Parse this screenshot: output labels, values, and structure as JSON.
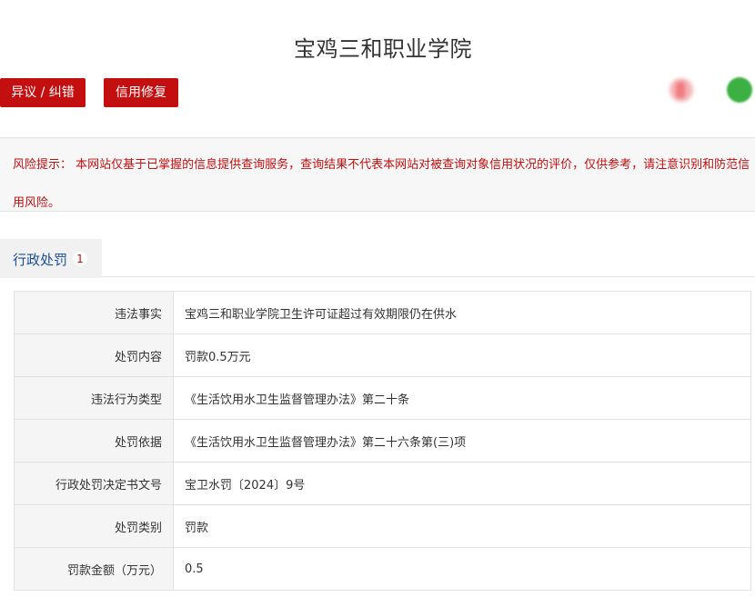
{
  "header": {
    "title": "宝鸡三和职业学院",
    "buttons": {
      "objection_label": "异议 / 纠错",
      "repair_label": "信用修复"
    }
  },
  "share_icons": [
    "share-icon-red",
    "share-icon-green"
  ],
  "risk_notice": {
    "text": "风险提示： 本网站仅基于已掌握的信息提供查询服务，查询结果不代表本网站对被查询对象信用状况的评价，仅供参考，请注意识别和防范信用风险。"
  },
  "tabs": [
    {
      "label": "行政处罚",
      "count": "1"
    }
  ],
  "record": {
    "rows": [
      {
        "label": "违法事实",
        "value": "宝鸡三和职业学院卫生许可证超过有效期限仍在供水"
      },
      {
        "label": "处罚内容",
        "value": "罚款0.5万元"
      },
      {
        "label": "违法行为类型",
        "value": "《生活饮用水卫生监督管理办法》第二十条"
      },
      {
        "label": "处罚依据",
        "value": "《生活饮用水卫生监督管理办法》第二十六条第(三)项"
      },
      {
        "label": "行政处罚决定书文号",
        "value": "宝卫水罚〔2024〕9号"
      },
      {
        "label": "处罚类别",
        "value": "罚款"
      },
      {
        "label": "罚款金额（万元）",
        "value": "0.5"
      }
    ]
  },
  "colors": {
    "accent_red": "#c40f10",
    "tab_blue": "#1b4f9c",
    "label_bg": "#f5f5f5",
    "border": "#e2e2e2"
  }
}
